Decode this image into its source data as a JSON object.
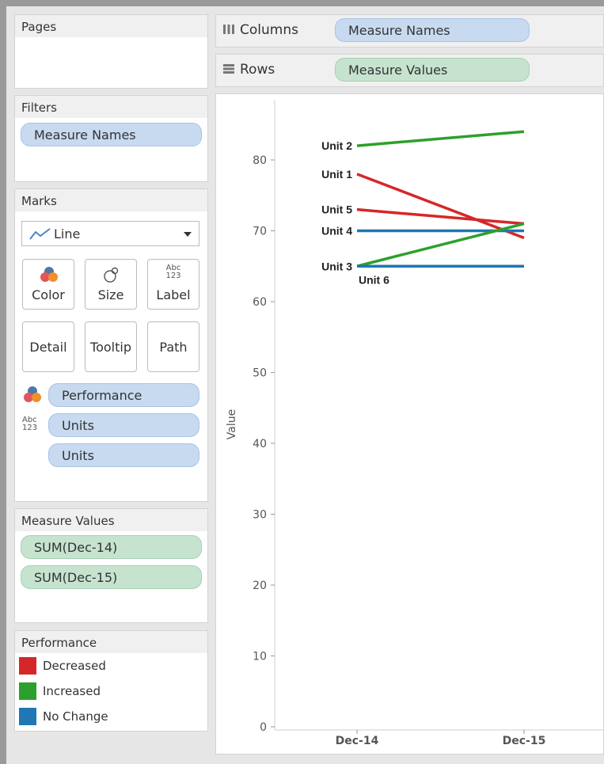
{
  "pages_card": {
    "title": "Pages"
  },
  "filters_card": {
    "title": "Filters",
    "pills": [
      "Measure Names"
    ]
  },
  "marks_card": {
    "title": "Marks",
    "mark_type": "Line",
    "buttons": {
      "color": "Color",
      "size": "Size",
      "label": "Label",
      "detail": "Detail",
      "tooltip": "Tooltip",
      "path": "Path"
    },
    "abc_icon": {
      "line1": "Abc",
      "line2": "123"
    },
    "fields": [
      "Performance",
      "Units",
      "Units"
    ]
  },
  "measure_values_card": {
    "title": "Measure Values",
    "pills": [
      "SUM(Dec-14)",
      "SUM(Dec-15)"
    ]
  },
  "performance_legend": {
    "title": "Performance",
    "items": [
      {
        "label": "Decreased",
        "color": "#d62728"
      },
      {
        "label": "Increased",
        "color": "#2ca02c"
      },
      {
        "label": "No Change",
        "color": "#1f77b4"
      }
    ]
  },
  "shelves": {
    "columns_label": "Columns",
    "columns_pill": "Measure Names",
    "rows_label": "Rows",
    "rows_pill": "Measure Values"
  },
  "chart_data": {
    "type": "line",
    "ylabel": "Value",
    "xlabel": "",
    "categories": [
      "Dec-14",
      "Dec-15"
    ],
    "yticks": [
      "0",
      "10",
      "20",
      "30",
      "40",
      "50",
      "60",
      "70",
      "80"
    ],
    "ylim": [
      0,
      87
    ],
    "series": [
      {
        "name": "Unit 2",
        "values": [
          82,
          84
        ],
        "color": "#2ca02c",
        "label_pos": "left"
      },
      {
        "name": "Unit 1",
        "values": [
          78,
          69
        ],
        "color": "#d62728",
        "label_pos": "left"
      },
      {
        "name": "Unit 5",
        "values": [
          73,
          71
        ],
        "color": "#d62728",
        "label_pos": "left"
      },
      {
        "name": "Unit 4",
        "values": [
          70,
          70
        ],
        "color": "#1f77b4",
        "label_pos": "left"
      },
      {
        "name": "Unit 3",
        "values": [
          65,
          71
        ],
        "color": "#2ca02c",
        "label_pos": "left"
      },
      {
        "name": "Unit 6",
        "values": [
          65,
          65
        ],
        "color": "#1f77b4",
        "label_pos": "below"
      }
    ]
  }
}
